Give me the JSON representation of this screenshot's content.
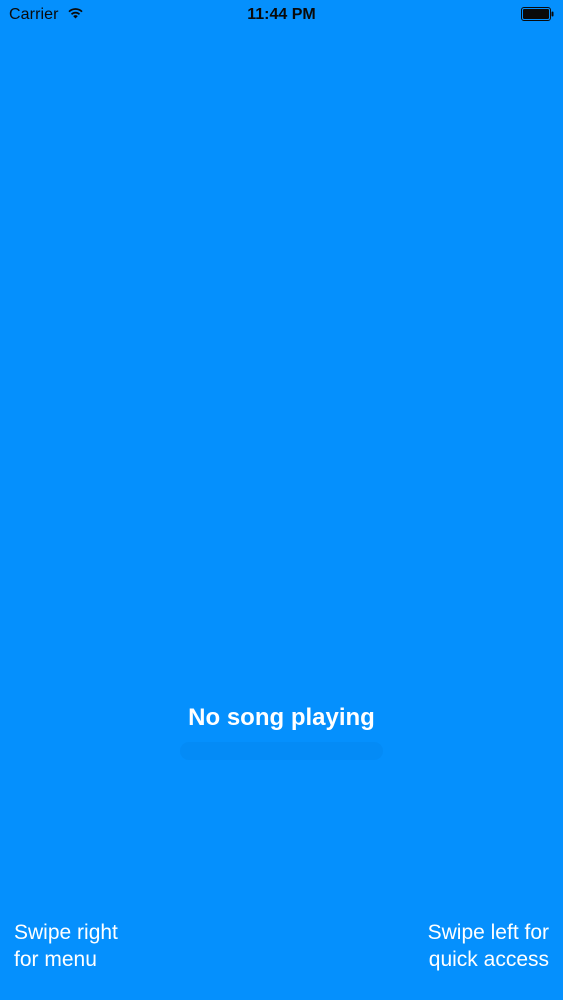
{
  "status_bar": {
    "carrier": "Carrier",
    "time": "11:44 PM",
    "wifi_icon": "wifi-icon",
    "battery_icon": "battery-icon"
  },
  "player": {
    "status_text": "No song playing"
  },
  "hints": {
    "left": {
      "line1": "Swipe right",
      "line2": "for menu"
    },
    "right": {
      "line1": "Swipe left for",
      "line2": "quick access"
    }
  },
  "colors": {
    "background": "#0590FD",
    "text": "#FFFFFF",
    "status_text": "#0A0A0A"
  }
}
